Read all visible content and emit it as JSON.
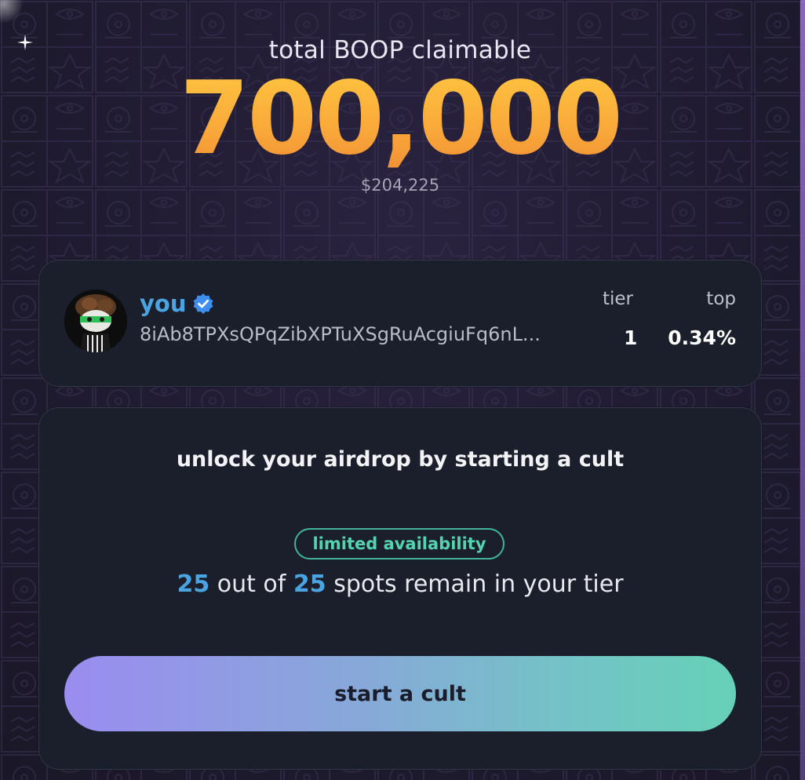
{
  "header": {
    "label": "total BOOP claimable",
    "amount": "700,000",
    "usd_value": "$204,225"
  },
  "user": {
    "name": "you",
    "verified": true,
    "wallet": "8iAb8TPXsQPqZibXPTuXSgRuAcgiuFq6nL...",
    "tier_label": "tier",
    "tier_value": "1",
    "top_label": "top",
    "top_value": "0.34%"
  },
  "cult": {
    "title": "unlock your airdrop by starting a cult",
    "badge": "limited availability",
    "spots_remaining": "25",
    "spots_text_1": "out of",
    "spots_total": "25",
    "spots_text_2": "spots remain in your tier",
    "button_label": "start a cult"
  },
  "colors": {
    "accent_blue": "#4aa4e2",
    "amount_gold": "#f9a83a",
    "badge_green": "#55d3b1",
    "button_gradient_start": "#9a8cf0",
    "button_gradient_end": "#66d1b6"
  },
  "icons": {
    "verified": "verified-check-icon",
    "sparkle": "sparkle-icon"
  }
}
